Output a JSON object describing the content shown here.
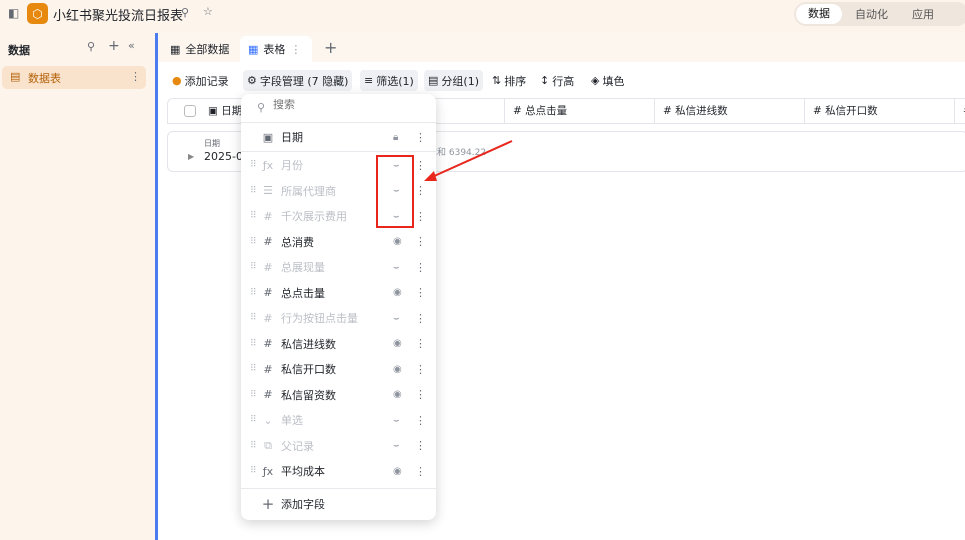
{
  "app": {
    "title": "小红书聚光投流日报表",
    "modes": [
      "数据",
      "自动化",
      "应用"
    ],
    "active_mode": "数据"
  },
  "sidebar": {
    "title": "数据",
    "items": [
      {
        "label": "数据表"
      }
    ]
  },
  "tabs": [
    {
      "label": "全部数据"
    },
    {
      "label": "表格"
    }
  ],
  "toolbar": {
    "add_record": "添加记录",
    "fields": "字段管理 (7 隐藏)",
    "filter": "筛选(1)",
    "group": "分组(1)",
    "sort": "排序",
    "row_height": "行高",
    "fill": "填色"
  },
  "table": {
    "columns": [
      "日期",
      "总点击量",
      "私信进线数",
      "私信开口数"
    ],
    "group": {
      "field": "日期",
      "value": "2025-09",
      "summary": "求和 6394.22"
    }
  },
  "field_menu": {
    "search_placeholder": "搜索",
    "primary": "日期",
    "add_field": "添加字段",
    "fields": [
      {
        "label": "月份",
        "icon": "fx",
        "visible": false
      },
      {
        "label": "所属代理商",
        "icon": "text",
        "visible": false
      },
      {
        "label": "千次展示费用",
        "icon": "#",
        "visible": false
      },
      {
        "label": "总消费",
        "icon": "#",
        "visible": true
      },
      {
        "label": "总展现量",
        "icon": "#",
        "visible": false
      },
      {
        "label": "总点击量",
        "icon": "#",
        "visible": true
      },
      {
        "label": "行为按钮点击量",
        "icon": "#",
        "visible": false
      },
      {
        "label": "私信进线数",
        "icon": "#",
        "visible": true
      },
      {
        "label": "私信开口数",
        "icon": "#",
        "visible": true
      },
      {
        "label": "私信留资数",
        "icon": "#",
        "visible": true
      },
      {
        "label": "单选",
        "icon": "select",
        "visible": false
      },
      {
        "label": "父记录",
        "icon": "link",
        "visible": false
      },
      {
        "label": "平均成本",
        "icon": "fx",
        "visible": true
      }
    ]
  }
}
